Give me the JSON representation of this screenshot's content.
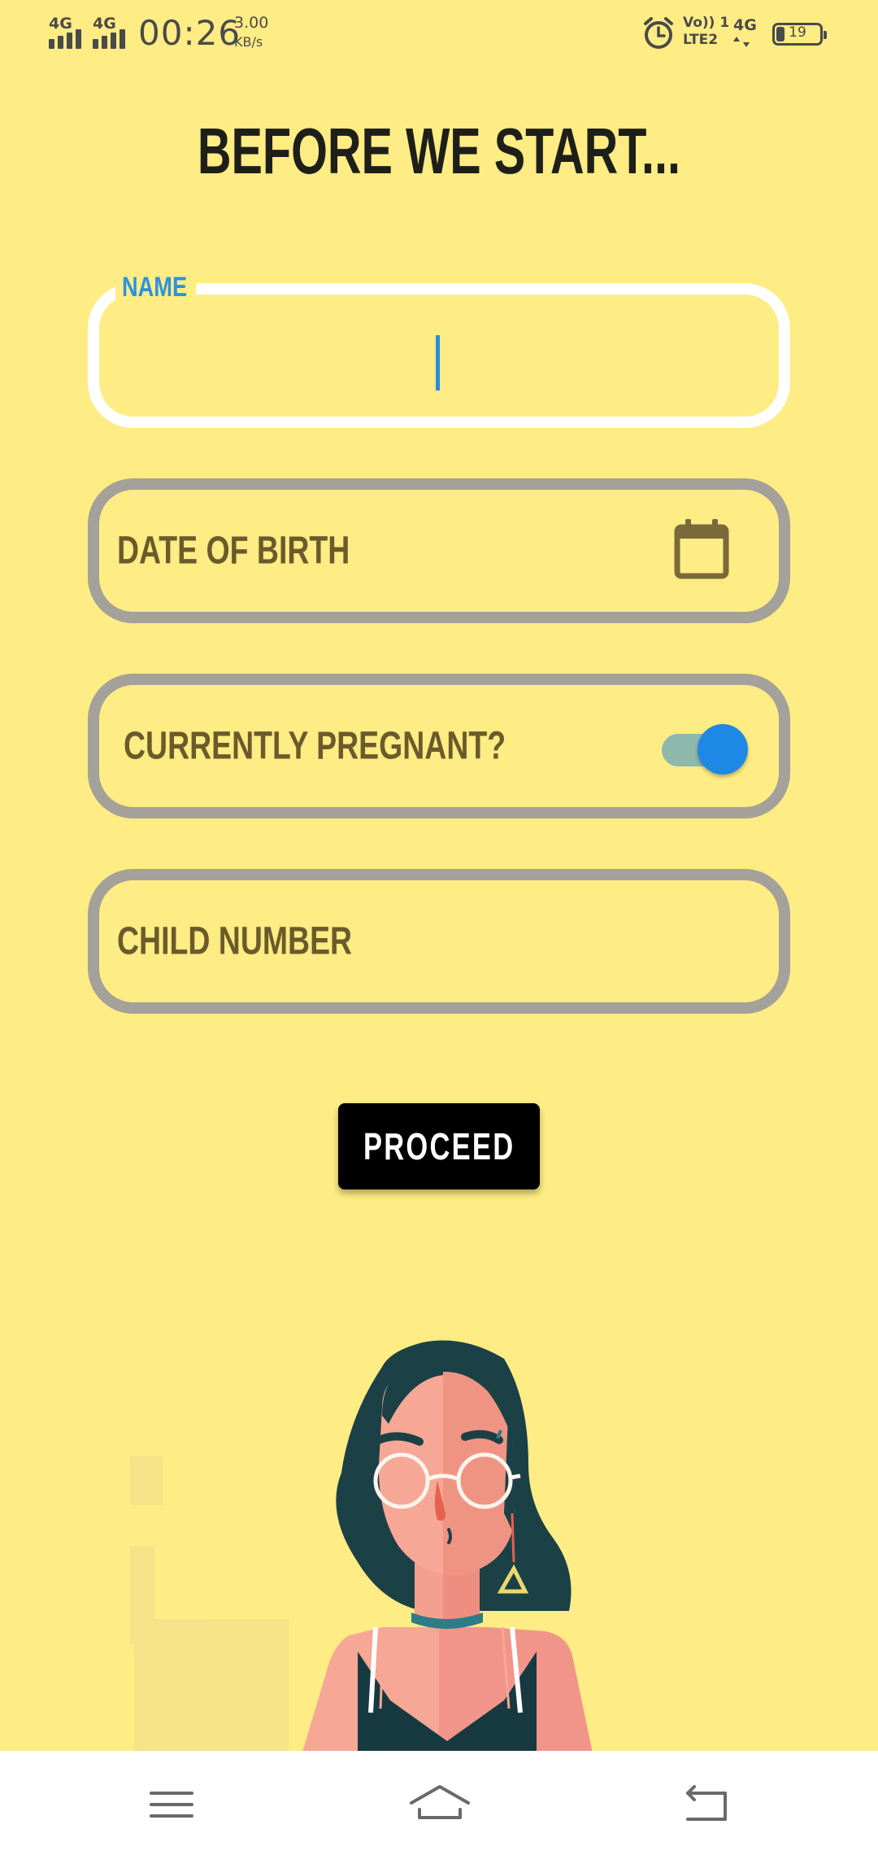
{
  "status_bar": {
    "sim1": "4G",
    "sim2": "4G",
    "time": "00:26",
    "net_speed_value": "3.00",
    "net_speed_unit": "KB/s",
    "volte_line1": "Vo)) 1",
    "volte_line2": "LTE2",
    "net2_type": "4G",
    "battery": "19"
  },
  "page": {
    "title": "BEFORE WE START..."
  },
  "form": {
    "name_label": "NAME",
    "name_value": "",
    "dob_label": "DATE OF BIRTH",
    "pregnant_label": "CURRENTLY PREGNANT?",
    "pregnant_toggle_on": true,
    "child_number_label": "CHILD NUMBER"
  },
  "actions": {
    "proceed_label": "PROCEED"
  },
  "colors": {
    "background": "#FEEC84",
    "field_border": "#A4A09A",
    "active_field_border": "#FFFFFF",
    "accent_blue": "#1E88E5",
    "label_text": "#6B5B2B",
    "title_text": "#1F1F1A"
  },
  "icons": {
    "calendar": "calendar-icon",
    "alarm": "alarm-icon",
    "nav_menu": "menu-icon",
    "nav_home": "home-icon",
    "nav_back": "back-icon"
  }
}
